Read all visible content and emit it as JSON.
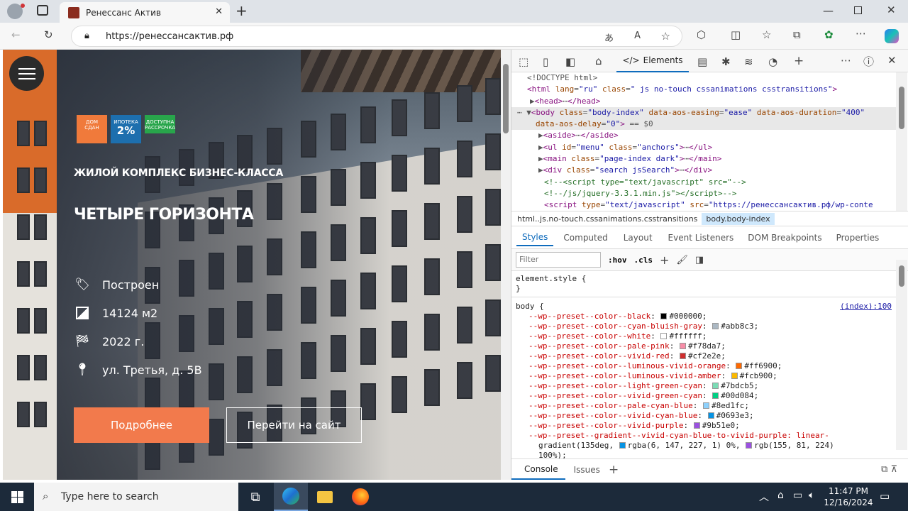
{
  "browser": {
    "tab_title": "Ренессанс Актив",
    "url": "https://ренессансактив.рф",
    "new_tab": "+"
  },
  "page": {
    "badges": [
      {
        "line1": "ДОМ",
        "line2": "СДАН"
      },
      {
        "line1": "ИПОТЕКА",
        "line2": "2%"
      },
      {
        "line1": "ДОСТУПНА",
        "line2": "РАССРОЧКА"
      }
    ],
    "subtitle": "ЖИЛОЙ КОМПЛЕКС БИЗНЕС-КЛАССА",
    "title": "ЧЕТЫРЕ ГОРИЗОНТА",
    "features": [
      {
        "icon": "tag-icon",
        "text": "Построен"
      },
      {
        "icon": "area-icon",
        "text": "14124 м2"
      },
      {
        "icon": "flag-icon",
        "text": "2022 г."
      },
      {
        "icon": "location-pin-icon",
        "text": "ул. Третья, д. 5В"
      }
    ],
    "button_more": "Подробнее",
    "button_site": "Перейти на сайт"
  },
  "devtools": {
    "elements_tab": "Elements",
    "breadcrumb": [
      "html..js.no-touch.cssanimations.csstransitions",
      "body.body-index"
    ],
    "subtabs": [
      "Styles",
      "Computed",
      "Layout",
      "Event Listeners",
      "DOM Breakpoints",
      "Properties"
    ],
    "filter_placeholder": "Filter",
    "hov": ":hov",
    "cls": ".cls",
    "element_style": "element.style {",
    "close_brace": "}",
    "body_selector": "body {",
    "source_link": "(index):100",
    "css_props": [
      {
        "name": "--wp--preset--color--black",
        "value": "#000000",
        "color": "#000000"
      },
      {
        "name": "--wp--preset--color--cyan-bluish-gray",
        "value": "#abb8c3",
        "color": "#abb8c3"
      },
      {
        "name": "--wp--preset--color--white",
        "value": "#ffffff",
        "color": "#ffffff"
      },
      {
        "name": "--wp--preset--color--pale-pink",
        "value": "#f78da7",
        "color": "#f78da7"
      },
      {
        "name": "--wp--preset--color--vivid-red",
        "value": "#cf2e2e",
        "color": "#cf2e2e"
      },
      {
        "name": "--wp--preset--color--luminous-vivid-orange",
        "value": "#ff6900",
        "color": "#ff6900"
      },
      {
        "name": "--wp--preset--color--luminous-vivid-amber",
        "value": "#fcb900",
        "color": "#fcb900"
      },
      {
        "name": "--wp--preset--color--light-green-cyan",
        "value": "#7bdcb5",
        "color": "#7bdcb5"
      },
      {
        "name": "--wp--preset--color--vivid-green-cyan",
        "value": "#00d084",
        "color": "#00d084"
      },
      {
        "name": "--wp--preset--color--pale-cyan-blue",
        "value": "#8ed1fc",
        "color": "#8ed1fc"
      },
      {
        "name": "--wp--preset--color--vivid-cyan-blue",
        "value": "#0693e3",
        "color": "#0693e3"
      },
      {
        "name": "--wp--preset--color--vivid-purple",
        "value": "#9b51e0",
        "color": "#9b51e0"
      }
    ],
    "gradient_line1": "--wp--preset--gradient--vivid-cyan-blue-to-vivid-purple: linear-",
    "gradient_line2a": "gradient(135deg,",
    "gradient_line2b": "rgba(6, 147, 227, 1) 0%,",
    "gradient_line2c": "rgb(155, 81, 224)",
    "gradient_line3": "100%);",
    "console_tabs": [
      "Console",
      "Issues"
    ]
  },
  "taskbar": {
    "search_placeholder": "Type here to search",
    "time": "11:47 PM",
    "date": "12/16/2024"
  }
}
